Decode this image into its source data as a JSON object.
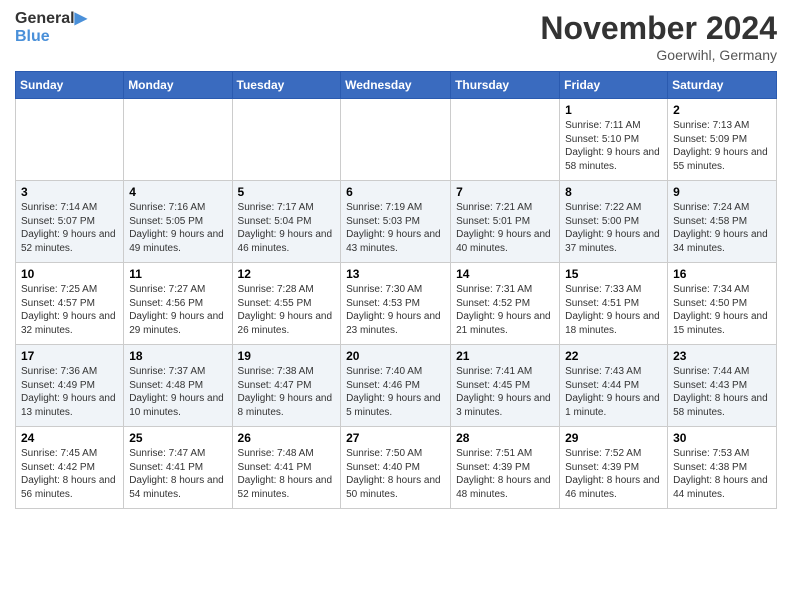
{
  "header": {
    "logo_line1": "General",
    "logo_line2": "Blue",
    "month": "November 2024",
    "location": "Goerwihl, Germany"
  },
  "days_of_week": [
    "Sunday",
    "Monday",
    "Tuesday",
    "Wednesday",
    "Thursday",
    "Friday",
    "Saturday"
  ],
  "weeks": [
    [
      {
        "day": "",
        "info": ""
      },
      {
        "day": "",
        "info": ""
      },
      {
        "day": "",
        "info": ""
      },
      {
        "day": "",
        "info": ""
      },
      {
        "day": "",
        "info": ""
      },
      {
        "day": "1",
        "info": "Sunrise: 7:11 AM\nSunset: 5:10 PM\nDaylight: 9 hours and 58 minutes."
      },
      {
        "day": "2",
        "info": "Sunrise: 7:13 AM\nSunset: 5:09 PM\nDaylight: 9 hours and 55 minutes."
      }
    ],
    [
      {
        "day": "3",
        "info": "Sunrise: 7:14 AM\nSunset: 5:07 PM\nDaylight: 9 hours and 52 minutes."
      },
      {
        "day": "4",
        "info": "Sunrise: 7:16 AM\nSunset: 5:05 PM\nDaylight: 9 hours and 49 minutes."
      },
      {
        "day": "5",
        "info": "Sunrise: 7:17 AM\nSunset: 5:04 PM\nDaylight: 9 hours and 46 minutes."
      },
      {
        "day": "6",
        "info": "Sunrise: 7:19 AM\nSunset: 5:03 PM\nDaylight: 9 hours and 43 minutes."
      },
      {
        "day": "7",
        "info": "Sunrise: 7:21 AM\nSunset: 5:01 PM\nDaylight: 9 hours and 40 minutes."
      },
      {
        "day": "8",
        "info": "Sunrise: 7:22 AM\nSunset: 5:00 PM\nDaylight: 9 hours and 37 minutes."
      },
      {
        "day": "9",
        "info": "Sunrise: 7:24 AM\nSunset: 4:58 PM\nDaylight: 9 hours and 34 minutes."
      }
    ],
    [
      {
        "day": "10",
        "info": "Sunrise: 7:25 AM\nSunset: 4:57 PM\nDaylight: 9 hours and 32 minutes."
      },
      {
        "day": "11",
        "info": "Sunrise: 7:27 AM\nSunset: 4:56 PM\nDaylight: 9 hours and 29 minutes."
      },
      {
        "day": "12",
        "info": "Sunrise: 7:28 AM\nSunset: 4:55 PM\nDaylight: 9 hours and 26 minutes."
      },
      {
        "day": "13",
        "info": "Sunrise: 7:30 AM\nSunset: 4:53 PM\nDaylight: 9 hours and 23 minutes."
      },
      {
        "day": "14",
        "info": "Sunrise: 7:31 AM\nSunset: 4:52 PM\nDaylight: 9 hours and 21 minutes."
      },
      {
        "day": "15",
        "info": "Sunrise: 7:33 AM\nSunset: 4:51 PM\nDaylight: 9 hours and 18 minutes."
      },
      {
        "day": "16",
        "info": "Sunrise: 7:34 AM\nSunset: 4:50 PM\nDaylight: 9 hours and 15 minutes."
      }
    ],
    [
      {
        "day": "17",
        "info": "Sunrise: 7:36 AM\nSunset: 4:49 PM\nDaylight: 9 hours and 13 minutes."
      },
      {
        "day": "18",
        "info": "Sunrise: 7:37 AM\nSunset: 4:48 PM\nDaylight: 9 hours and 10 minutes."
      },
      {
        "day": "19",
        "info": "Sunrise: 7:38 AM\nSunset: 4:47 PM\nDaylight: 9 hours and 8 minutes."
      },
      {
        "day": "20",
        "info": "Sunrise: 7:40 AM\nSunset: 4:46 PM\nDaylight: 9 hours and 5 minutes."
      },
      {
        "day": "21",
        "info": "Sunrise: 7:41 AM\nSunset: 4:45 PM\nDaylight: 9 hours and 3 minutes."
      },
      {
        "day": "22",
        "info": "Sunrise: 7:43 AM\nSunset: 4:44 PM\nDaylight: 9 hours and 1 minute."
      },
      {
        "day": "23",
        "info": "Sunrise: 7:44 AM\nSunset: 4:43 PM\nDaylight: 8 hours and 58 minutes."
      }
    ],
    [
      {
        "day": "24",
        "info": "Sunrise: 7:45 AM\nSunset: 4:42 PM\nDaylight: 8 hours and 56 minutes."
      },
      {
        "day": "25",
        "info": "Sunrise: 7:47 AM\nSunset: 4:41 PM\nDaylight: 8 hours and 54 minutes."
      },
      {
        "day": "26",
        "info": "Sunrise: 7:48 AM\nSunset: 4:41 PM\nDaylight: 8 hours and 52 minutes."
      },
      {
        "day": "27",
        "info": "Sunrise: 7:50 AM\nSunset: 4:40 PM\nDaylight: 8 hours and 50 minutes."
      },
      {
        "day": "28",
        "info": "Sunrise: 7:51 AM\nSunset: 4:39 PM\nDaylight: 8 hours and 48 minutes."
      },
      {
        "day": "29",
        "info": "Sunrise: 7:52 AM\nSunset: 4:39 PM\nDaylight: 8 hours and 46 minutes."
      },
      {
        "day": "30",
        "info": "Sunrise: 7:53 AM\nSunset: 4:38 PM\nDaylight: 8 hours and 44 minutes."
      }
    ]
  ]
}
